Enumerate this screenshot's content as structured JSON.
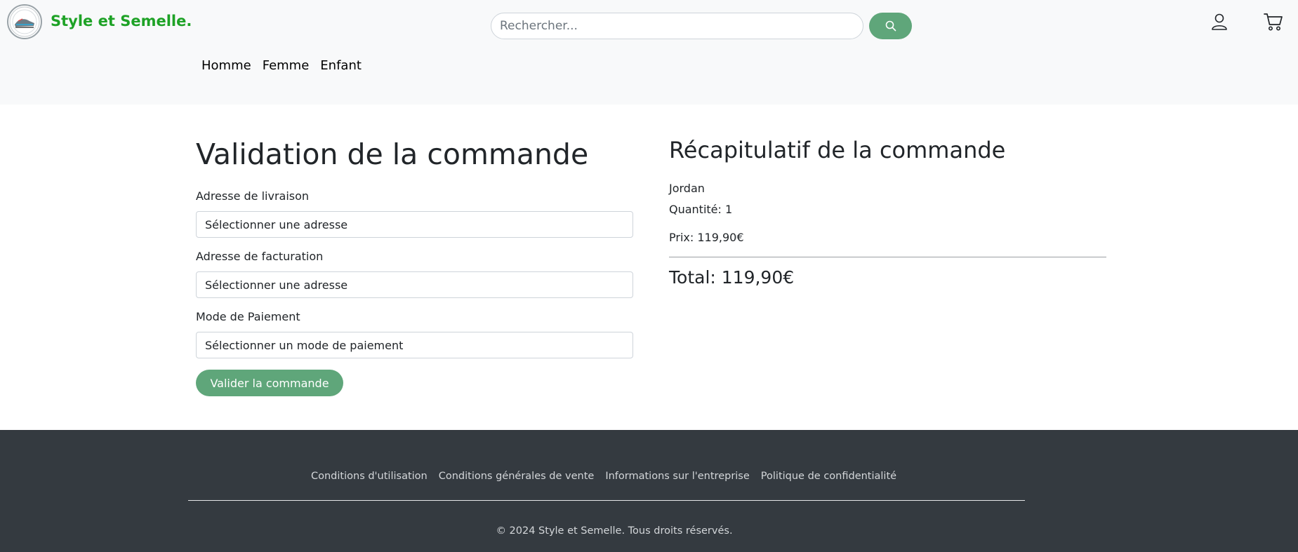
{
  "header": {
    "brand": "Style et Semelle.",
    "search": {
      "placeholder": "Rechercher...",
      "value": ""
    },
    "nav": [
      "Homme",
      "Femme",
      "Enfant"
    ]
  },
  "checkout": {
    "title": "Validation de la commande",
    "shipping": {
      "label": "Adresse de livraison",
      "value": "Sélectionner une adresse"
    },
    "billing": {
      "label": "Adresse de facturation",
      "value": "Sélectionner une adresse"
    },
    "payment": {
      "label": "Mode de Paiement",
      "value": "Sélectionner un mode de paiement"
    },
    "submit_label": "Valider la commande"
  },
  "summary": {
    "title": "Récapitulatif de la commande",
    "product_name": "Jordan",
    "quantity": "Quantité: 1",
    "price": "Prix: 119,90€",
    "total": "Total: 119,90€"
  },
  "footer": {
    "links": [
      "Conditions d'utilisation",
      "Conditions générales de vente",
      "Informations sur l'entreprise",
      "Politique de confidentialité"
    ],
    "copyright": "© 2024 Style et Semelle. Tous droits réservés."
  },
  "colors": {
    "brand": "#1ea226",
    "accent_button": "#5fa67a",
    "footer_bg": "#343a40",
    "header_bg": "#f8f9fa"
  },
  "icons": [
    "logo-image",
    "search-icon",
    "user-icon",
    "cart-icon"
  ]
}
